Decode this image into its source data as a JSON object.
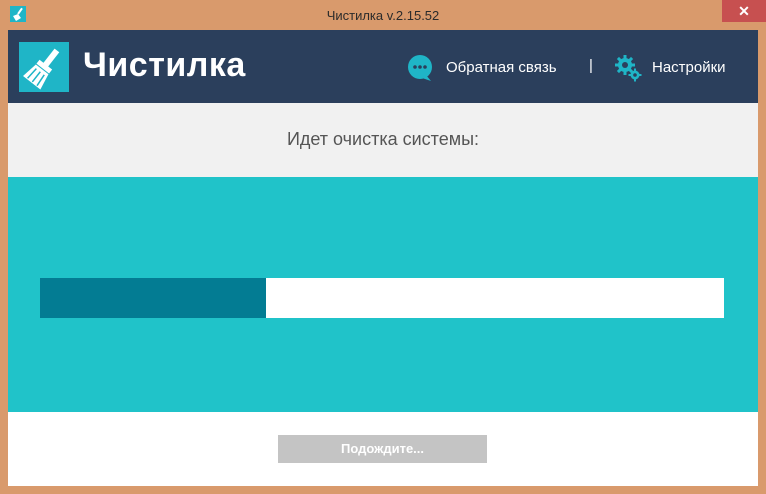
{
  "window": {
    "title": "Чистилка v.2.15.52",
    "close_glyph": "✕"
  },
  "header": {
    "app_name": "Чистилка",
    "logo_icon": "broom-icon",
    "nav": {
      "feedback_label": "Обратная связь",
      "feedback_icon": "chat-bubble-icon",
      "separator": "|",
      "settings_label": "Настройки",
      "settings_icon": "gears-icon"
    }
  },
  "main": {
    "status_text": "Идет очистка системы:",
    "progress_fraction": 0.33
  },
  "footer": {
    "button_label": "Подождите..."
  },
  "colors": {
    "header_bg": "#2b3f5c",
    "accent_teal": "#20c3c9",
    "progress_fill": "#037c93",
    "status_band_bg": "#f1f1f1",
    "button_disabled_bg": "#c4c4c4",
    "window_frame": "#d99a6c",
    "close_button": "#c75050"
  }
}
